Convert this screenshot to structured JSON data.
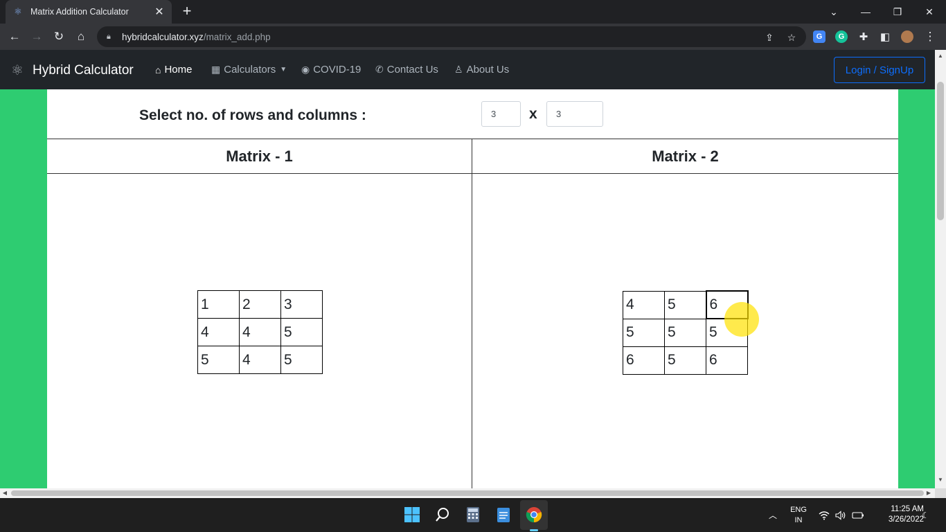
{
  "browser": {
    "tab_title": "Matrix Addition Calculator",
    "url_host": "hybridcalculator.xyz",
    "url_path": "/matrix_add.php"
  },
  "navbar": {
    "brand": "Hybrid Calculator",
    "items": [
      {
        "label": "Home",
        "icon": "home-icon"
      },
      {
        "label": "Calculators",
        "icon": "calculator-icon"
      },
      {
        "label": "COVID-19",
        "icon": "virus-icon"
      },
      {
        "label": "Contact Us",
        "icon": "phone-icon"
      },
      {
        "label": "About Us",
        "icon": "person-icon"
      }
    ],
    "login_label": "Login / SignUp"
  },
  "selector": {
    "label": "Select no. of rows and columns :",
    "rows": "3",
    "separator": "x",
    "cols": "3"
  },
  "matrix1": {
    "title": "Matrix - 1",
    "rows": [
      [
        "1",
        "2",
        "3"
      ],
      [
        "4",
        "4",
        "5"
      ],
      [
        "5",
        "4",
        "5"
      ]
    ]
  },
  "matrix2": {
    "title": "Matrix - 2",
    "rows": [
      [
        "4",
        "5",
        "6"
      ],
      [
        "5",
        "5",
        "5"
      ],
      [
        "6",
        "5",
        "6"
      ]
    ]
  },
  "scroll_top_icon": "arrow-up-icon",
  "taskbar": {
    "lang_top": "ENG",
    "lang_bottom": "IN",
    "time": "11:25 AM",
    "date": "3/26/2022"
  },
  "colors": {
    "page_background": "#2ecc71",
    "navbar": "#212529",
    "login_border": "#0d6efd",
    "scroll_top_button": "#e53935"
  }
}
